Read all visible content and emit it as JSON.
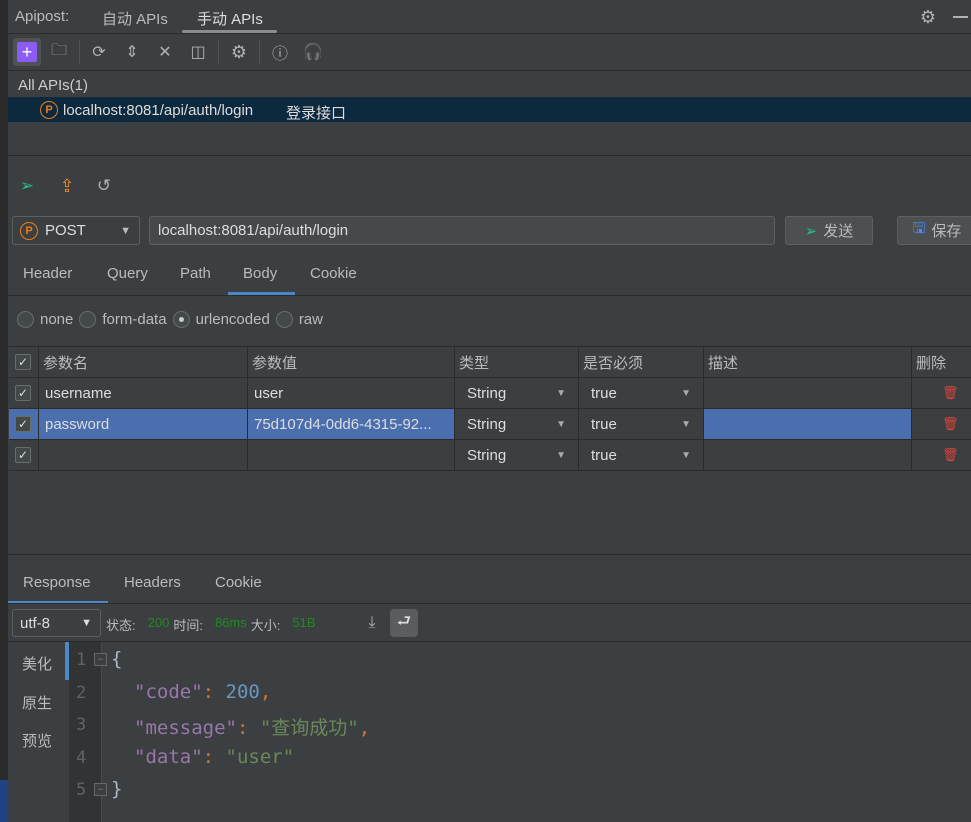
{
  "app": {
    "label": "Apipost:",
    "tabs": [
      {
        "label": "自动 APIs"
      },
      {
        "label": "手动 APIs",
        "active": true
      }
    ]
  },
  "toolbar": {
    "icons": [
      "plus-icon",
      "new-folder-icon",
      "refresh-icon",
      "expand-icon",
      "collapse-icon",
      "split-icon",
      "settings-icon",
      "help-icon",
      "headset-icon"
    ]
  },
  "tree": {
    "root": "All APIs(1)",
    "items": [
      {
        "method_badge": "P",
        "url": "localhost:8081/api/auth/login",
        "name": "登录接口"
      }
    ]
  },
  "request": {
    "method_badge": "P",
    "method": "POST",
    "url": "localhost:8081/api/auth/login",
    "send_label": "发送",
    "save_label": "保存",
    "tabs": [
      "Header",
      "Query",
      "Path",
      "Body",
      "Cookie"
    ],
    "active_tab": "Body",
    "body_types": [
      "none",
      "form-data",
      "urlencoded",
      "raw"
    ],
    "selected_body_type": "urlencoded",
    "columns": [
      "参数名",
      "参数值",
      "类型",
      "是否必须",
      "描述",
      "删除"
    ],
    "rows": [
      {
        "name": "username",
        "value": "user",
        "type": "String",
        "required": "true",
        "desc": "",
        "checked": true
      },
      {
        "name": "password",
        "value": "75d107d4-0dd6-4315-92...",
        "type": "String",
        "required": "true",
        "desc": "",
        "checked": true,
        "selected": true
      },
      {
        "name": "",
        "value": "",
        "type": "String",
        "required": "true",
        "desc": "",
        "checked": true
      }
    ]
  },
  "response": {
    "tabs": [
      "Response",
      "Headers",
      "Cookie"
    ],
    "active_tab": "Response",
    "encoding": "utf-8",
    "status_label": "状态:",
    "status": "200",
    "time_label": "时间:",
    "time": "86ms",
    "size_label": "大小:",
    "size": "51B",
    "views": [
      "美化",
      "原生",
      "预览"
    ],
    "active_view": "美化",
    "lines": [
      "1",
      "2",
      "3",
      "4",
      "5"
    ],
    "json": {
      "code_key": "\"code\"",
      "code_val": "200",
      "message_key": "\"message\"",
      "message_val": "\"查询成功\"",
      "data_key": "\"data\"",
      "data_val": "\"user\""
    }
  },
  "colors": {
    "accent": "#4a88c7",
    "key": "#9876aa",
    "number": "#6897bb",
    "string": "#6a8759",
    "status_ok": "#2d9d2d",
    "selection": "#4b6eaf"
  }
}
